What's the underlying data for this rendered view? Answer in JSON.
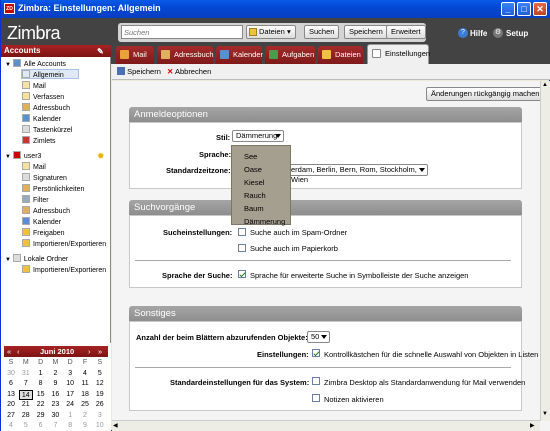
{
  "window": {
    "title": "Zimbra: Einstellungen: Allgemein",
    "minimize": "_",
    "maximize": "□",
    "close": "✕",
    "app_icon": "ZD"
  },
  "header": {
    "logo": "Zimbra",
    "search": {
      "placeholder": "Suchen",
      "scope": "Dateien",
      "search_btn": "Suchen",
      "save_btn": "Speichern",
      "advanced_btn": "Erweitert"
    },
    "help": "Hilfe",
    "setup": "Setup"
  },
  "tabs": [
    {
      "label": "Mail",
      "color": "#e8a33a"
    },
    {
      "label": "Adressbuch",
      "color": "#e0b060"
    },
    {
      "label": "Kalender",
      "color": "#5a8fd0"
    },
    {
      "label": "Aufgaben",
      "color": "#4c9a4c"
    },
    {
      "label": "Dateien",
      "color": "#f0c040"
    },
    {
      "label": "Einstellungen",
      "color": "#ffffff"
    }
  ],
  "sidebar": {
    "title": "Accounts",
    "items": [
      {
        "label": "Alle Accounts",
        "icon": "all-accounts-icon"
      },
      {
        "label": "Allgemein",
        "icon": "general-icon"
      },
      {
        "label": "Mail",
        "icon": "mail-icon"
      },
      {
        "label": "Verfassen",
        "icon": "compose-icon"
      },
      {
        "label": "Adressbuch",
        "icon": "addressbook-icon"
      },
      {
        "label": "Kalender",
        "icon": "calendar-icon"
      },
      {
        "label": "Tastenkürzel",
        "icon": "shortcut-icon"
      },
      {
        "label": "Zimlets",
        "icon": "zimlet-icon"
      },
      {
        "label": "user3",
        "icon": "account-icon"
      },
      {
        "label": "Mail",
        "icon": "mail-icon"
      },
      {
        "label": "Signaturen",
        "icon": "signature-icon"
      },
      {
        "label": "Persönlichkeiten",
        "icon": "persona-icon"
      },
      {
        "label": "Filter",
        "icon": "filter-icon"
      },
      {
        "label": "Adressbuch",
        "icon": "addressbook-icon"
      },
      {
        "label": "Kalender",
        "icon": "calendar-icon"
      },
      {
        "label": "Freigaben",
        "icon": "share-icon"
      },
      {
        "label": "Importieren/Exportieren",
        "icon": "import-icon"
      },
      {
        "label": "Lokale Ordner",
        "icon": "local-folder-icon"
      },
      {
        "label": "Importieren/Exportieren",
        "icon": "import-icon"
      }
    ]
  },
  "mini_calendar": {
    "month": "Juni 2010",
    "prev_year": "«",
    "prev": "‹",
    "next": "›",
    "next_year": "»",
    "weekdays": [
      "S",
      "M",
      "D",
      "M",
      "D",
      "F",
      "S"
    ],
    "weeks": [
      [
        "30",
        "31",
        "1",
        "2",
        "3",
        "4",
        "5"
      ],
      [
        "6",
        "7",
        "8",
        "9",
        "10",
        "11",
        "12"
      ],
      [
        "13",
        "14",
        "15",
        "16",
        "17",
        "18",
        "19"
      ],
      [
        "20",
        "21",
        "22",
        "23",
        "24",
        "25",
        "26"
      ],
      [
        "27",
        "28",
        "29",
        "30",
        "1",
        "2",
        "3"
      ],
      [
        "4",
        "5",
        "6",
        "7",
        "8",
        "9",
        "10"
      ]
    ],
    "today": "14"
  },
  "toolbar": {
    "save": "Speichern",
    "cancel": "Abbrechen"
  },
  "undo_btn": "Änderungen rückgängig machen",
  "login": {
    "title": "Anmeldeoptionen",
    "style_label": "Stil:",
    "style_value": "Dämmerung",
    "language_label": "Sprache:",
    "timezone_label": "Standardzeitzone:",
    "timezone_value": "erdam, Berlin, Bern, Rom, Stockholm, Wien",
    "style_options": [
      "See",
      "Oase",
      "Kiesel",
      "Rauch",
      "Baum",
      "Dämmerung"
    ]
  },
  "search_section": {
    "title": "Suchvorgänge",
    "settings_label": "Sucheinstellungen:",
    "opt1": "Suche auch im Spam-Ordner",
    "opt2": "Suche auch im Papierkorb",
    "lang_label": "Sprache der Suche:",
    "lang_opt": "Sprache für erweiterte Suche in Symbolleiste der Suche anzeigen"
  },
  "misc": {
    "title": "Sonstiges",
    "sheets_label": "Anzahl der beim Blättern abzurufenden Objekte:",
    "sheets_value": "50",
    "settings_label": "Einstellungen:",
    "settings_opt": "Kontrollkästchen für die schnelle Auswahl von Objekten in Listen anzeigen",
    "system_label": "Standardeinstellungen für das System:",
    "system_opt1": "Zimbra Desktop als Standardanwendung für Mail verwenden",
    "system_opt2": "Notizen aktivieren"
  }
}
